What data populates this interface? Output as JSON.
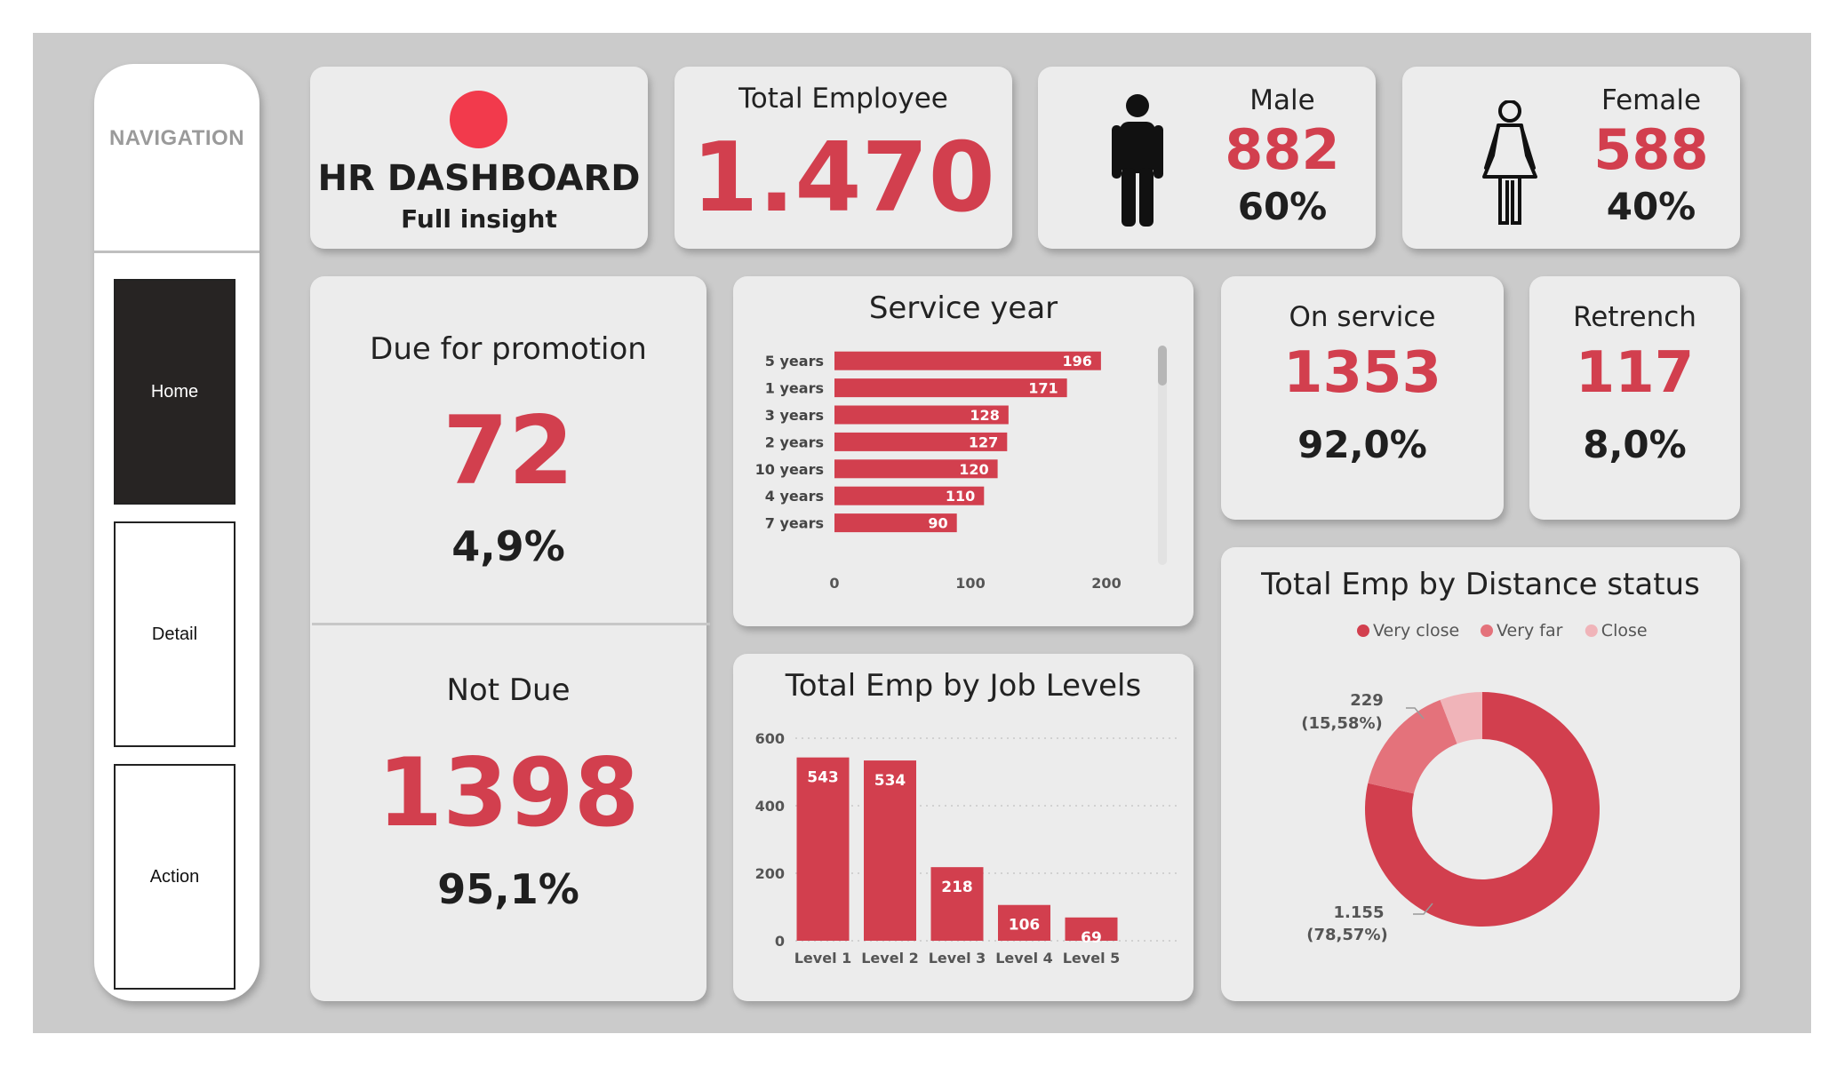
{
  "nav": {
    "title": "NAVIGATION",
    "items": [
      {
        "label": "Home",
        "active": true
      },
      {
        "label": "Detail",
        "active": false
      },
      {
        "label": "Action",
        "active": false
      }
    ]
  },
  "header": {
    "title": "HR DASHBOARD",
    "subtitle": "Full insight",
    "dot_color": "#f23a4c"
  },
  "kpi": {
    "total": {
      "label": "Total Employee",
      "value": "1.470"
    },
    "male": {
      "label": "Male",
      "value": "882",
      "pct": "60%"
    },
    "female": {
      "label": "Female",
      "value": "588",
      "pct": "40%"
    },
    "due": {
      "label": "Due for promotion",
      "value": "72",
      "pct": "4,9%"
    },
    "not_due": {
      "label": "Not Due",
      "value": "1398",
      "pct": "95,1%"
    },
    "on_service": {
      "label": "On service",
      "value": "1353",
      "pct": "92,0%"
    },
    "retrench": {
      "label": "Retrench",
      "value": "117",
      "pct": "8,0%"
    }
  },
  "colors": {
    "accent": "#d23f4e",
    "accent_mid": "#e4727b",
    "accent_light": "#f0b4b9",
    "card": "#ececec",
    "background": "#cbcbcb"
  },
  "chart_data": [
    {
      "type": "bar",
      "orientation": "horizontal",
      "title": "Service year",
      "categories": [
        "5 years",
        "1 years",
        "3 years",
        "2 years",
        "10 years",
        "4 years",
        "7 years"
      ],
      "values": [
        196,
        171,
        128,
        127,
        120,
        110,
        90
      ],
      "xlim": [
        0,
        200
      ],
      "xticks": [
        "0",
        "100",
        "200"
      ],
      "grid": false
    },
    {
      "type": "bar",
      "title": "Total Emp by Job Levels",
      "categories": [
        "Level 1",
        "Level 2",
        "Level 3",
        "Level 4",
        "Level 5"
      ],
      "values": [
        543,
        534,
        218,
        106,
        69
      ],
      "ylim": [
        0,
        600
      ],
      "yticks": [
        "0",
        "200",
        "400",
        "600"
      ],
      "grid": true
    },
    {
      "type": "pie",
      "title": "Total Emp by Distance status",
      "legend": [
        "Very close",
        "Very far",
        "Close"
      ],
      "legend_placement": "top",
      "values": [
        1155,
        229,
        86
      ],
      "labels": [
        {
          "value": "1.155",
          "pct": "(78,57%)"
        },
        {
          "value": "229",
          "pct": "(15,58%)"
        }
      ]
    }
  ]
}
